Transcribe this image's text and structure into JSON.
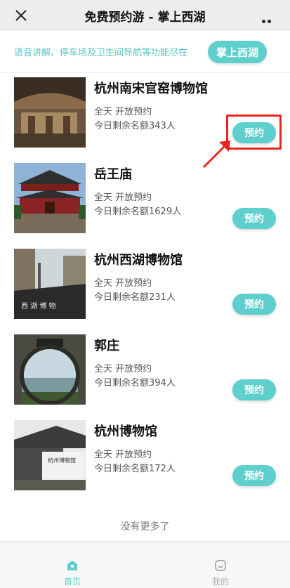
{
  "header": {
    "title": "免费预约游 - 掌上西湖"
  },
  "promo": {
    "text": "语音讲解、停车场及卫生间导航等功能尽在",
    "button_label": "掌上西湖"
  },
  "venues": [
    {
      "name": "杭州南宋官窑博物馆",
      "availability": "全天 开放预约",
      "quota": "今日剩余名额343人",
      "button_label": "预约"
    },
    {
      "name": "岳王庙",
      "availability": "全天 开放预约",
      "quota": "今日剩余名额1629人",
      "button_label": "预约"
    },
    {
      "name": "杭州西湖博物馆",
      "availability": "全天 开放预约",
      "quota": "今日剩余名额231人",
      "button_label": "预约"
    },
    {
      "name": "郭庄",
      "availability": "全天 开放预约",
      "quota": "今日剩余名额394人",
      "button_label": "预约"
    },
    {
      "name": "杭州博物馆",
      "availability": "全天 开放预约",
      "quota": "今日剩余名额172人",
      "button_label": "预约"
    }
  ],
  "footer_note": "没有更多了",
  "tabbar": {
    "home_label": "首页",
    "mine_label": "我的"
  },
  "colors": {
    "accent": "#5ecfcc",
    "promo_text": "#58c4c4",
    "highlight": "#e6231f",
    "header_bg": "#ededed"
  },
  "icons": {
    "close": "close-icon",
    "more": "more-dots-icon",
    "home_tab": "home-icon",
    "mine_tab": "user-icon"
  }
}
